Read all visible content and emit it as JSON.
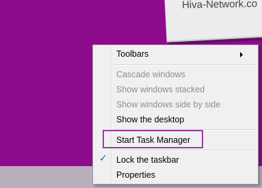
{
  "desktop": {
    "background_color": "#8e0b8e",
    "watermark_text": "Hiva-Network.co"
  },
  "context_menu": {
    "items": [
      {
        "label": "Toolbars",
        "enabled": true,
        "submenu": true
      },
      {
        "label": "Cascade windows",
        "enabled": false
      },
      {
        "label": "Show windows stacked",
        "enabled": false
      },
      {
        "label": "Show windows side by side",
        "enabled": false
      },
      {
        "label": "Show the desktop",
        "enabled": true
      },
      {
        "label": "Start Task Manager",
        "enabled": true,
        "highlighted_outline": true
      },
      {
        "label": "Lock the taskbar",
        "enabled": true,
        "checked": true
      },
      {
        "label": "Properties",
        "enabled": true
      }
    ],
    "check_icon": "checkmark-icon",
    "submenu_icon": "submenu-arrow-icon"
  },
  "colors": {
    "highlight_outline": "#9b3b9b",
    "check_mark": "#1a5ea8",
    "disabled_text": "#8d8d8d"
  }
}
